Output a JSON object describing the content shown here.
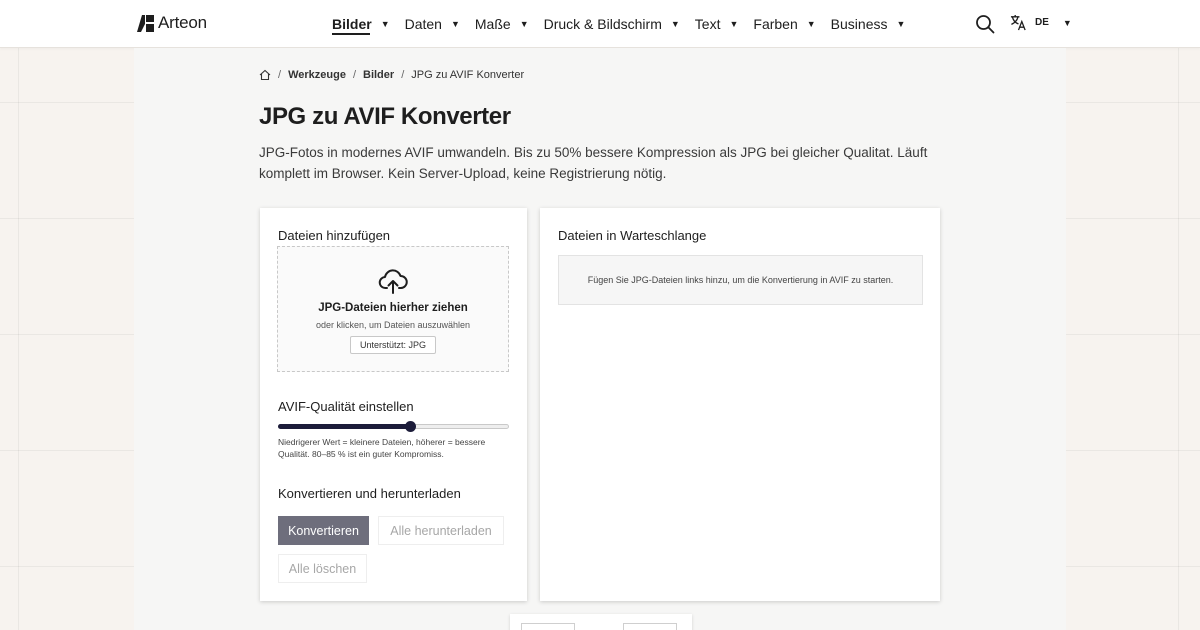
{
  "brand": {
    "name": "Arteon"
  },
  "nav": {
    "items": [
      {
        "label": "Bilder",
        "active": true
      },
      {
        "label": "Daten",
        "active": false
      },
      {
        "label": "Maße",
        "active": false
      },
      {
        "label": "Druck & Bildschirm",
        "active": false
      },
      {
        "label": "Text",
        "active": false
      },
      {
        "label": "Farben",
        "active": false
      },
      {
        "label": "Business",
        "active": false
      }
    ],
    "caret": "▼"
  },
  "language": {
    "code": "DE"
  },
  "breadcrumb": {
    "items": [
      "Werkzeuge",
      "Bilder",
      "JPG zu AVIF Konverter"
    ],
    "separator": "/"
  },
  "page": {
    "title": "JPG zu AVIF Konverter",
    "intro": "JPG-Fotos in modernes AVIF umwandeln. Bis zu 50% bessere Kompression als JPG bei gleicher Qualitat. Läuft komplett im Browser. Kein Server-Upload, keine Registrierung nötig."
  },
  "upload": {
    "heading": "Dateien hinzufügen",
    "drop_title": "JPG-Dateien hierher ziehen",
    "drop_subtitle": "oder klicken, um Dateien auszuwählen",
    "supported": "Unterstützt: JPG"
  },
  "quality": {
    "heading": "AVIF-Qualität einstellen",
    "value_fraction": 0.57,
    "hint": "Niedrigerer Wert = kleinere Dateien, höherer = bessere Qualität. 80–85 % ist ein guter Kompromiss."
  },
  "actions": {
    "heading": "Konvertieren und herunterladen",
    "convert": "Konvertieren",
    "download_all": "Alle herunterladen",
    "clear_all": "Alle löschen"
  },
  "queue": {
    "heading": "Dateien in Warteschlange",
    "empty_message": "Fügen Sie JPG-Dateien links hinzu, um die Konvertierung in AVIF zu starten."
  },
  "colors": {
    "accent": "#1c1c3a",
    "primary_button": "#6e6e7c",
    "background": "#f7f3ef"
  },
  "icons": [
    "logo-icon",
    "search-icon",
    "translate-icon",
    "home-icon",
    "cloud-upload-icon"
  ]
}
